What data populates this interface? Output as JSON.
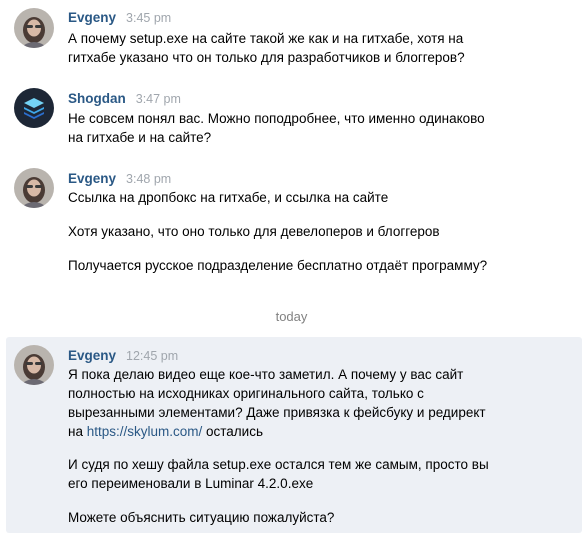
{
  "messages": [
    {
      "author": "Evgeny",
      "time": "3:45 pm",
      "lines": [
        "А почему setup.exe на сайте такой же как и на гитхабе, хотя на",
        "гитхабе указано что он только для разработчиков и блоггеров?"
      ]
    },
    {
      "author": "Shogdan",
      "time": "3:47 pm",
      "lines": [
        "Не совсем понял вас. Можно поподробнее, что именно одинаково",
        "на гитхабе и на сайте?"
      ]
    },
    {
      "author": "Evgeny",
      "time": "3:48 pm",
      "paragraphs": [
        "Ссылка на дропбокс на гитхабе, и ссылка на сайте",
        "Хотя указано, что оно только для девелоперов и блоггеров",
        "Получается русское подразделение бесплатно отдаёт программу?"
      ]
    },
    {
      "author": "Evgeny",
      "time": "12:45 pm",
      "lines": [
        "Я пока делаю видео еще кое-что заметил. А почему у вас сайт",
        "полностью на исходниках оригинального сайта, только с",
        "вырезанными элементами? Даже привязка к фейсбуку и редирект"
      ],
      "last_line_prefix": "на ",
      "link": "https://skylum.com/",
      "last_line_suffix": " остались",
      "paragraph2": [
        "И судя по хешу файла setup.exe остался тем же самым, просто вы",
        "его переименовали в Luminar 4.2.0.exe"
      ],
      "paragraph3": "Можете объяснить ситуацию пожалуйста?"
    }
  ],
  "divider": "today",
  "colors": {
    "author": "#2a5885",
    "time": "#a0a6ad",
    "link": "#2a5885",
    "unread_bg": "#edf0f5",
    "divider": "#828282"
  },
  "icons": {
    "evgeny_avatar": "user-photo-avatar",
    "shogdan_avatar": "layers-logo-avatar"
  }
}
